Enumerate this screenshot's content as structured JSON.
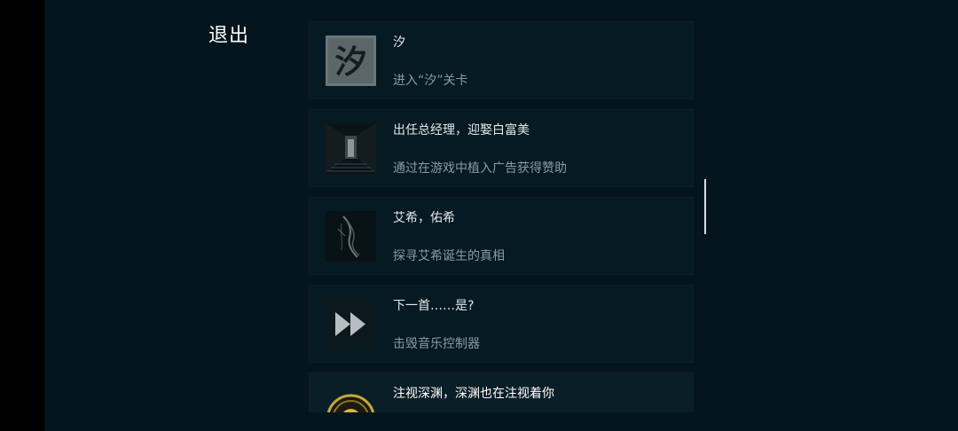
{
  "exit_label": "退出",
  "achievements": [
    {
      "title": "汐",
      "desc": "进入“汐”关卡",
      "icon": "xi-character-icon",
      "icon_text": "汐"
    },
    {
      "title": "出任总经理，迎娶白富美",
      "desc": "通过在游戏中植入广告获得赞助",
      "icon": "corridor-door-icon"
    },
    {
      "title": "艾希，佑希",
      "desc": "探寻艾希诞生的真相",
      "icon": "figure-silhouette-icon"
    },
    {
      "title": "下一首……是?",
      "desc": "击毁音乐控制器",
      "icon": "fast-forward-icon"
    },
    {
      "title": "注视深渊，深渊也在注视着你",
      "desc": "",
      "icon": "golden-eye-icon"
    }
  ]
}
